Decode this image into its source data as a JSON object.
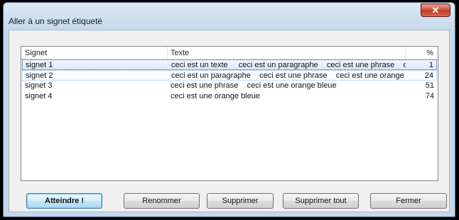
{
  "window": {
    "title": "Aller à un signet étiqueté",
    "close_symbol": "✕"
  },
  "list": {
    "columns": [
      "Signet",
      "Texte",
      "%"
    ],
    "rows": [
      {
        "name": "signet 1",
        "text": "ceci est un texte     ceci est un paragraphe    ceci est une phrase    ceci...",
        "pct": "1",
        "state": "selected"
      },
      {
        "name": "signet 2",
        "text": "ceci est un paragraphe    ceci est une phrase    ceci est une orange bleue",
        "pct": "24",
        "state": "hover"
      },
      {
        "name": "signet 3",
        "text": "ceci est une phrase    ceci est une orange bleue",
        "pct": "51",
        "state": "normal"
      },
      {
        "name": "signet 4",
        "text": "ceci est une orange bleue",
        "pct": "74",
        "state": "normal"
      }
    ]
  },
  "buttons": {
    "goto": "Atteindre !",
    "rename": "Renommer",
    "delete": "Supprimer",
    "delete_all": "Supprimer tout",
    "close": "Fermer"
  }
}
